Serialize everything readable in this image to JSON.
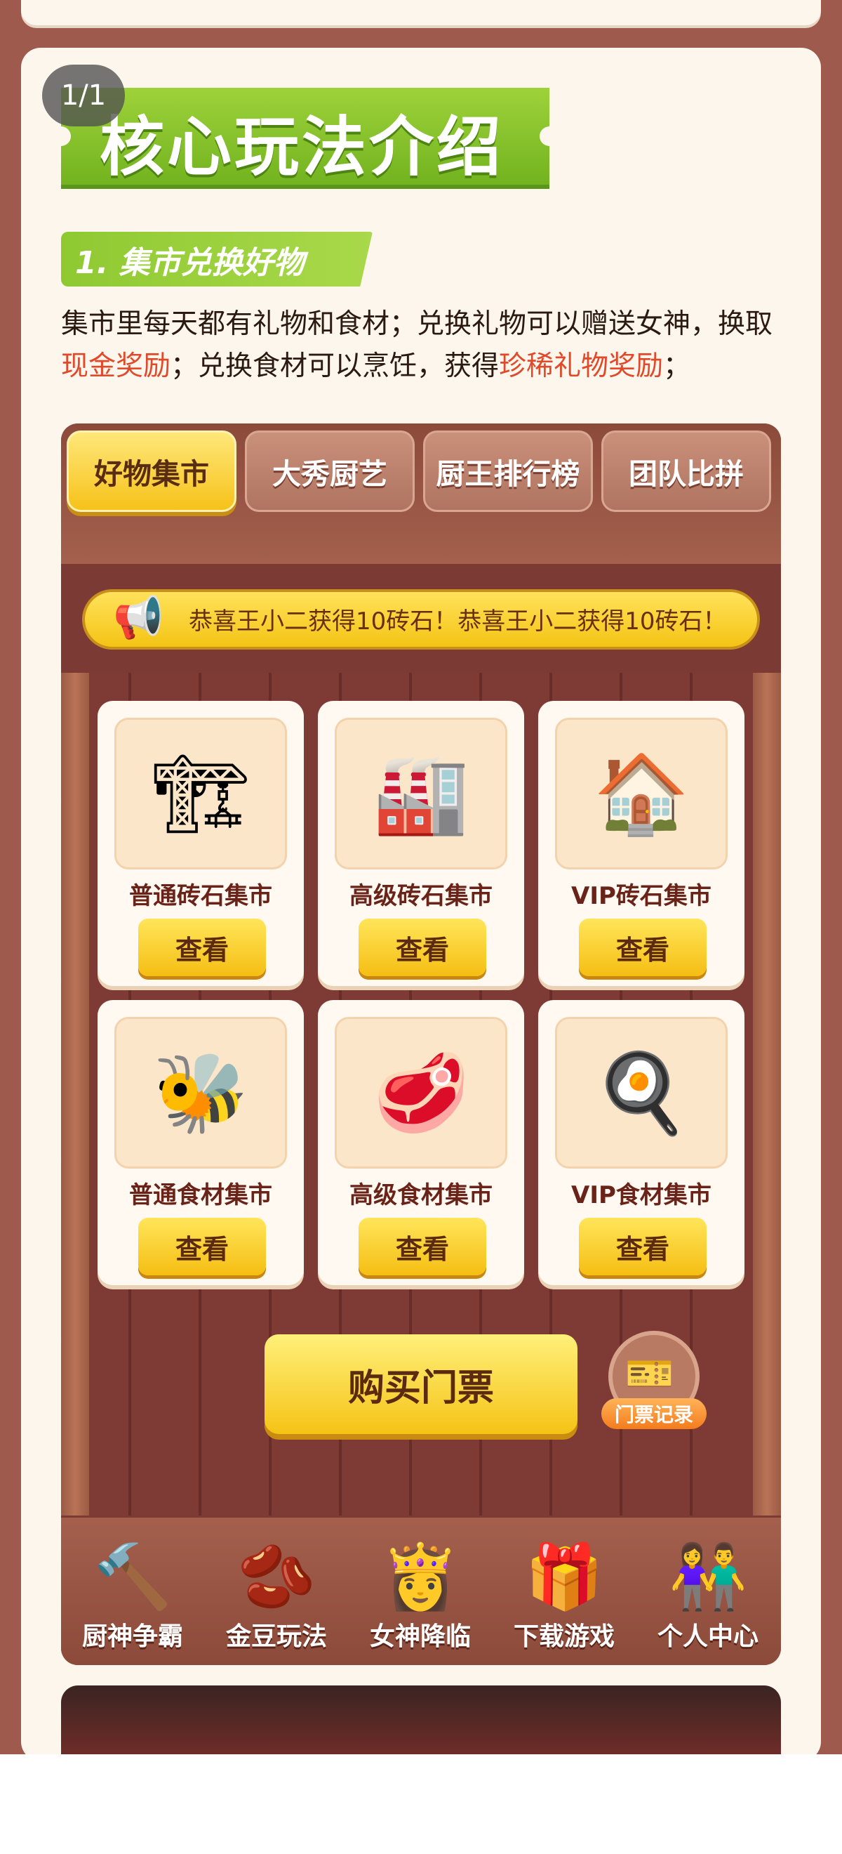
{
  "page_indicator": "1/1",
  "title": "核心玩法介绍",
  "section": {
    "subtitle": "1. 集市兑换好物",
    "desc_part1": "集市里每天都有礼物和食材；兑换礼物可以赠送女神，换取",
    "desc_hl1": "现金奖励",
    "desc_part2": "；兑换食材可以烹饪，获得",
    "desc_hl2": "珍稀礼物奖励",
    "desc_part3": "；"
  },
  "tabs": [
    "好物集市",
    "大秀厨艺",
    "厨王排行榜",
    "团队比拼"
  ],
  "ticker": "恭喜王小二获得10砖石！恭喜王小二获得10砖石！",
  "shops": [
    {
      "name": "普通砖石集市",
      "button": "查看",
      "icon": "stone-workshop-icon"
    },
    {
      "name": "高级砖石集市",
      "button": "查看",
      "icon": "crane-workshop-icon"
    },
    {
      "name": "VIP砖石集市",
      "button": "查看",
      "icon": "blue-house-icon"
    },
    {
      "name": "普通食材集市",
      "button": "查看",
      "icon": "beehive-icon"
    },
    {
      "name": "高级食材集市",
      "button": "查看",
      "icon": "market-stall-icon"
    },
    {
      "name": "VIP食材集市",
      "button": "查看",
      "icon": "stove-icon"
    }
  ],
  "buy_button": "购买门票",
  "ticket_record": "门票记录",
  "bottom_nav": [
    {
      "label": "厨神争霸",
      "icon": "hammer-icon"
    },
    {
      "label": "金豆玩法",
      "icon": "gold-bean-icon"
    },
    {
      "label": "女神降临",
      "icon": "goddess-icon"
    },
    {
      "label": "下载游戏",
      "icon": "gift-icon"
    },
    {
      "label": "个人中心",
      "icon": "profile-icon"
    }
  ]
}
